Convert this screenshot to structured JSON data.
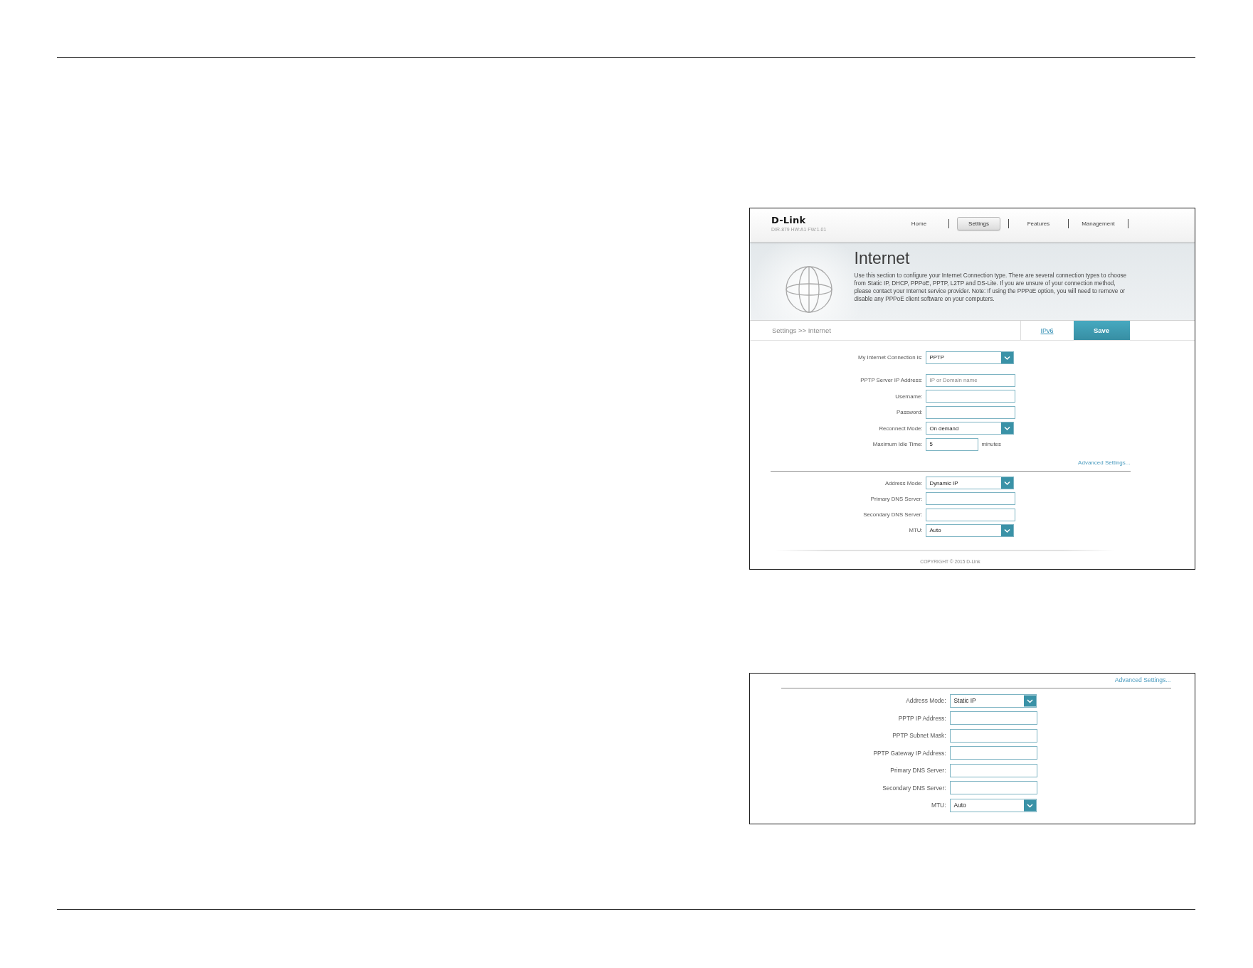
{
  "main_screenshot": {
    "logo": "D-Link",
    "model_info": "DIR-879 HW:A1 FW:1.01",
    "nav": [
      {
        "label": "Home",
        "selected": false
      },
      {
        "label": "Settings",
        "selected": true
      },
      {
        "label": "Features",
        "selected": false
      },
      {
        "label": "Management",
        "selected": false
      }
    ],
    "banner": {
      "title": "Internet",
      "description": "Use this section to configure your Internet Connection type. There are several connection types to choose from Static IP, DHCP, PPPoE, PPTP, L2TP and DS-Lite. If you are unsure of your connection method, please contact your Internet service provider. Note: If using the PPPoE option, you will need to remove or disable any PPPoE client software on your computers."
    },
    "breadcrumb": "Settings >> Internet",
    "ipv6_link": "IPv6",
    "save_button": "Save",
    "connection_fields": [
      {
        "kind": "select",
        "label": "My Internet Connection is:",
        "value": "PPTP"
      }
    ],
    "pptp_fields": [
      {
        "kind": "text",
        "label": "PPTP Server IP Address:",
        "placeholder": "IP or Domain name"
      },
      {
        "kind": "text",
        "label": "Username:"
      },
      {
        "kind": "text",
        "label": "Password:"
      },
      {
        "kind": "select",
        "label": "Reconnect Mode:",
        "value": "On demand"
      },
      {
        "kind": "number",
        "label": "Maximum Idle Time:",
        "value": "5",
        "unit": "minutes"
      }
    ],
    "advanced_link": "Advanced Settings...",
    "address_fields": [
      {
        "kind": "select",
        "label": "Address Mode:",
        "value": "Dynamic IP"
      },
      {
        "kind": "text",
        "label": "Primary DNS Server:"
      },
      {
        "kind": "text",
        "label": "Secondary DNS Server:"
      },
      {
        "kind": "select",
        "label": "MTU:",
        "value": "Auto"
      }
    ],
    "copyright": "COPYRIGHT © 2015 D-Link"
  },
  "static_ip_screenshot": {
    "advanced_link": "Advanced Settings...",
    "address_fields": [
      {
        "kind": "select",
        "label": "Address Mode:",
        "value": "Static IP"
      },
      {
        "kind": "text",
        "label": "PPTP IP Address:"
      },
      {
        "kind": "text",
        "label": "PPTP Subnet Mask:"
      },
      {
        "kind": "text",
        "label": "PPTP Gateway IP Address:"
      },
      {
        "kind": "text",
        "label": "Primary DNS Server:"
      },
      {
        "kind": "text",
        "label": "Secondary DNS Server:"
      },
      {
        "kind": "select",
        "label": "MTU:",
        "value": "Auto"
      }
    ]
  }
}
